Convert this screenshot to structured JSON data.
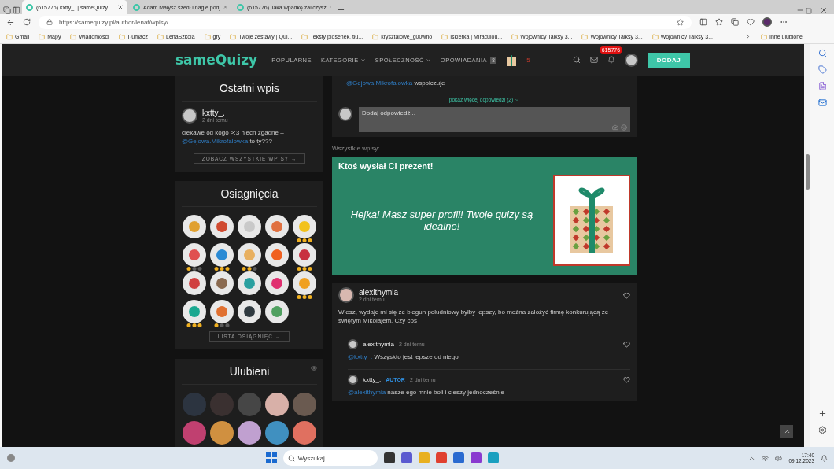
{
  "browser": {
    "tabs": [
      {
        "title": "(615776) kxtty_. | sameQuizy",
        "selected": true
      },
      {
        "title": "Adam Małysz szedł i nagle podj",
        "selected": false
      },
      {
        "title": "(615776) Jaka wpadkę zaliczysz",
        "selected": false
      }
    ],
    "url": "https://samequizy.pl/author/lenat/wpisy/",
    "bookmarks": [
      "Gmail",
      "Mapy",
      "Wiadomości",
      "Tłumacz",
      "LenaSzkola",
      "gry",
      "Twoje zestawy | Qui...",
      "Teksty piosenek, tłu...",
      "krysztalowe_g00wno",
      "Iskierka | Miraculou...",
      "Wojownicy Talksy 3...",
      "Wojownicy Talksy 3...",
      "Wojownicy Talksy 3..."
    ],
    "other_bookmarks": "Inne ulubione"
  },
  "site": {
    "logo": "sameQuizy",
    "nav": [
      {
        "label": "POPULARNE",
        "dropdown": false
      },
      {
        "label": "KATEGORIE",
        "dropdown": true
      },
      {
        "label": "SPOŁECZNOŚĆ",
        "dropdown": true
      },
      {
        "label": "OPOWIADANIA",
        "dropdown": false,
        "count": "8"
      }
    ],
    "gift_count": "5",
    "notifications": "615776",
    "add_button": "DODAJ"
  },
  "latest_post": {
    "title": "Ostatni wpis",
    "author": "kxtty_.",
    "time": "2 dni temu",
    "text": "ciekawe od kogo >:3 niech zgadne – ",
    "mention": "@Gejowa.Mikrofalowka",
    "text_end": " to ty???",
    "button": "ZOBACZ WSZYSTKIE WPISY →"
  },
  "achievements": {
    "title": "Osiągnięcia",
    "button": "LISTA OSIĄGNIĘĆ →",
    "items": [
      {
        "color": "#e0a030"
      },
      {
        "color": "#d04a30"
      },
      {
        "color": "#c9c9c9"
      },
      {
        "color": "#e07040"
      },
      {
        "color": "#f2c21c",
        "stars": 3
      },
      {
        "color": "#e05050",
        "stars": 1
      },
      {
        "color": "#2a8ad4",
        "stars": 3
      },
      {
        "color": "#e8b060",
        "stars": 2
      },
      {
        "color": "#f06020"
      },
      {
        "color": "#c83040",
        "stars": 3
      },
      {
        "color": "#d04040"
      },
      {
        "color": "#8a6a50"
      },
      {
        "color": "#2aa0a0"
      },
      {
        "color": "#e03070"
      },
      {
        "color": "#f0a020",
        "stars": 3
      },
      {
        "color": "#1aa890",
        "stars": 3
      },
      {
        "color": "#e07030",
        "stars": 1
      },
      {
        "color": "#303a40"
      },
      {
        "color": "#50a060"
      }
    ]
  },
  "favorites": {
    "title": "Ulubieni",
    "people": [
      {
        "color": "#2c3440"
      },
      {
        "color": "#3a3030"
      },
      {
        "color": "#464646"
      },
      {
        "color": "#d8b0a8"
      },
      {
        "color": "#6a5a50"
      },
      {
        "color": "#c04070"
      },
      {
        "color": "#d09040"
      },
      {
        "color": "#c0a0d0"
      },
      {
        "color": "#4090c0"
      },
      {
        "color": "#e07060"
      }
    ]
  },
  "thread": {
    "reply_mention": "@Gejowa.Mikrofalowka",
    "reply_text": " wspolczuje",
    "more_replies": "pokaż więcej odpowiedzi (2)",
    "reply_placeholder": "Dodaj odpowiedź..."
  },
  "all_posts_label": "Wszystkie wpisy:",
  "gift": {
    "title": "Ktoś wysłał Ci prezent!",
    "message": "Hejka! Masz super profil! Twoje quizy są idealne!"
  },
  "post": {
    "author": "alexithymia",
    "time": "2 dni temu",
    "text": "Wiesz, wydaje mi się że biegun południowy byłby lepszy, bo można założyć firmę konkurującą ze świętym Mikolajem. Czy coś",
    "replies": [
      {
        "author": "alexithymia",
        "time": "2 dni temu",
        "mention": "@kxtty_.",
        "text": " Wszyskto jest lepsze od niego"
      },
      {
        "author": "kxtty_.",
        "role": "AUTOR",
        "time": "2 dni temu",
        "mention": "@alexithymia",
        "text": " nasze ego mnie boli i cieszy jednocześnie"
      }
    ]
  },
  "taskbar": {
    "search": "Wyszukaj",
    "time": "17:40",
    "date": "09.12.2023"
  }
}
